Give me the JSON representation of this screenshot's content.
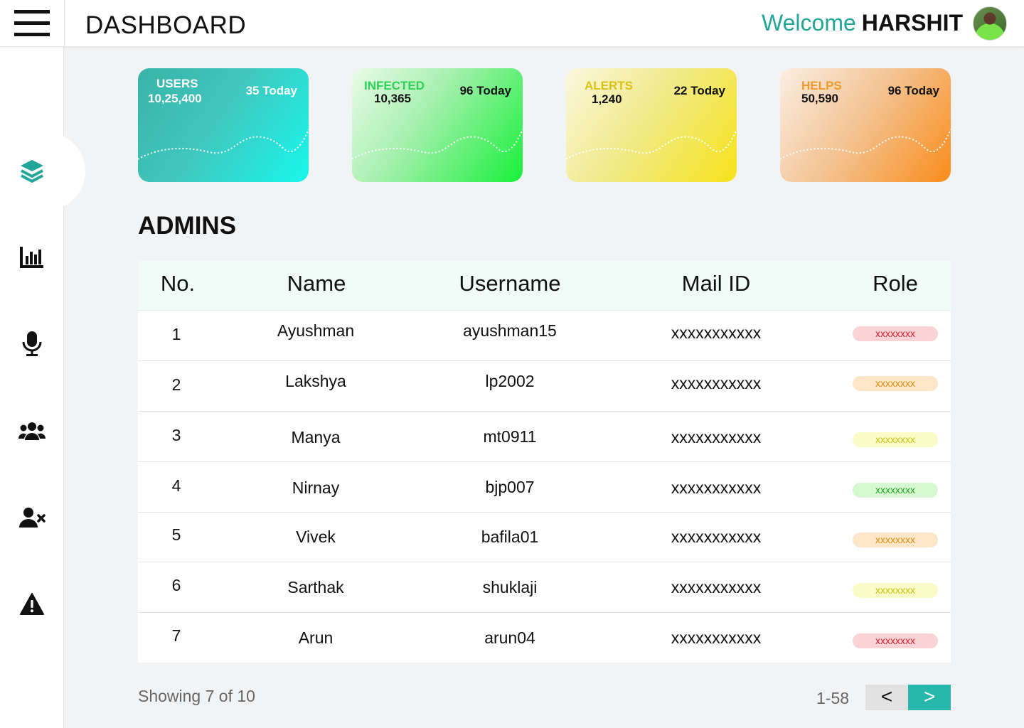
{
  "header": {
    "title": "DASHBOARD",
    "welcome_text": "Welcome",
    "username": "HARSHIT"
  },
  "sidebar": {
    "items": [
      {
        "icon": "layers-icon",
        "active": true
      },
      {
        "icon": "bar-chart-icon"
      },
      {
        "icon": "microphone-icon"
      },
      {
        "icon": "users-group-icon"
      },
      {
        "icon": "user-remove-icon"
      },
      {
        "icon": "warning-icon"
      }
    ],
    "accent_color": "#22a699"
  },
  "cards": [
    {
      "label": "USERS",
      "total": "10,25,400",
      "today": "35 Today",
      "label_color": "#ffffff",
      "text_color": "#ffffff"
    },
    {
      "label": "INFECTED",
      "total": "10,365",
      "today": "96 Today",
      "label_color": "#2ed158",
      "text_color": "#111111"
    },
    {
      "label": "ALERTS",
      "total": "1,240",
      "today": "22 Today",
      "label_color": "#d8c21a",
      "text_color": "#111111"
    },
    {
      "label": "HELPS",
      "total": "50,590",
      "today": "96 Today",
      "label_color": "#ef9a2a",
      "text_color": "#111111"
    }
  ],
  "admins": {
    "title": "ADMINS",
    "columns": [
      "No.",
      "Name",
      "Username",
      "Mail ID",
      "Role"
    ],
    "rows": [
      {
        "no": "1",
        "name": "Ayushman",
        "username": "ayushman15",
        "mail": "xxxxxxxxxxx",
        "role": "xxxxxxxx",
        "role_color": "red"
      },
      {
        "no": "2",
        "name": "Lakshya",
        "username": "lp2002",
        "mail": "xxxxxxxxxxx",
        "role": "xxxxxxxx",
        "role_color": "orange"
      },
      {
        "no": "3",
        "name": "Manya",
        "username": "mt0911",
        "mail": "xxxxxxxxxxx",
        "role": "xxxxxxxx",
        "role_color": "yellow"
      },
      {
        "no": "4",
        "name": "Nirnay",
        "username": "bjp007",
        "mail": "xxxxxxxxxxx",
        "role": "xxxxxxxx",
        "role_color": "green"
      },
      {
        "no": "5",
        "name": "Vivek",
        "username": "bafila01",
        "mail": "xxxxxxxxxxx",
        "role": "xxxxxxxx",
        "role_color": "orange"
      },
      {
        "no": "6",
        "name": "Sarthak",
        "username": "shuklaji",
        "mail": "xxxxxxxxxxx",
        "role": "xxxxxxxx",
        "role_color": "yellow"
      },
      {
        "no": "7",
        "name": "Arun",
        "username": "arun04",
        "mail": "xxxxxxxxxxx",
        "role": "xxxxxxxx",
        "role_color": "red"
      }
    ]
  },
  "pagination": {
    "showing": "Showing 7 of 10",
    "range": "1-58",
    "prev": "<",
    "next": ">"
  }
}
